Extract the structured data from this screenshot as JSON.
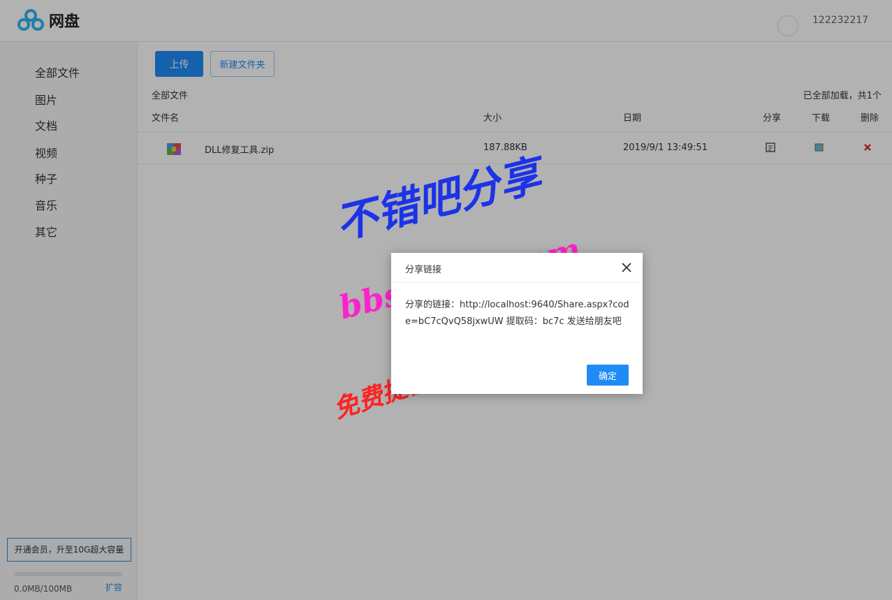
{
  "header": {
    "brand": "网盘",
    "username": "122232217"
  },
  "sidebar": {
    "items": [
      {
        "label": "全部文件"
      },
      {
        "label": "图片"
      },
      {
        "label": "文档"
      },
      {
        "label": "视频"
      },
      {
        "label": "种子"
      },
      {
        "label": "音乐"
      },
      {
        "label": "其它"
      }
    ],
    "upgrade_label": "开通会员，升至10G超大容量",
    "storage_text": "0.0MB/100MB",
    "storage_used_fraction": 0.0,
    "expand_label": "扩容"
  },
  "toolbar": {
    "upload_label": "上传",
    "new_folder_label": "新建文件夹"
  },
  "list": {
    "breadcrumb": "全部文件",
    "status": "已全部加载，共1个",
    "columns": {
      "name": "文件名",
      "size": "大小",
      "date": "日期",
      "share": "分享",
      "download": "下载",
      "delete": "删除"
    },
    "rows": [
      {
        "name": "DLL修复工具.zip",
        "size": "187.88KB",
        "date": "2019/9/1 13:49:51"
      }
    ]
  },
  "dialog": {
    "title": "分享链接",
    "body": "分享的链接：http://localhost:9640/Share.aspx?code=bC7cQvQ58jxwUW 提取码：bc7c 发送给朋友吧",
    "ok_label": "确定"
  },
  "watermark": {
    "line1": "不错吧分享",
    "line2": "bbs.bcb5.com",
    "line3": "免费提供精品资源下载"
  },
  "colors": {
    "accent": "#1f8cf5",
    "overlay": "rgba(0,0,0,0.3)"
  }
}
